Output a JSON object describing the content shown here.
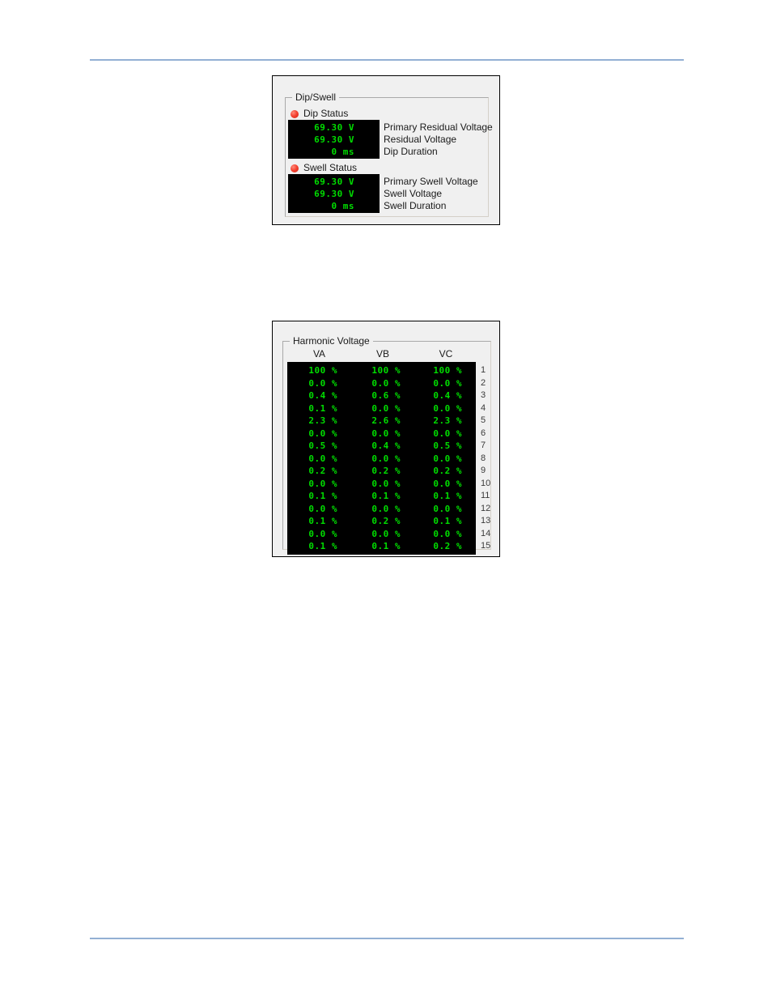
{
  "page": {
    "rule_color": "#93b0d4",
    "background": "#ffffff"
  },
  "dip_swell_panel": {
    "legend": "Dip/Swell",
    "dip": {
      "status_label": "Dip Status",
      "status_led_color": "#f4402f",
      "readouts": [
        {
          "value": "69.30 V",
          "label": "Primary Residual Voltage"
        },
        {
          "value": "69.30 V",
          "label": "Residual Voltage"
        },
        {
          "value": "0 ms",
          "label": "Dip Duration"
        }
      ]
    },
    "swell": {
      "status_label": "Swell Status",
      "status_led_color": "#f4402f",
      "readouts": [
        {
          "value": "69.30 V",
          "label": "Primary Swell Voltage"
        },
        {
          "value": "69.30 V",
          "label": "Swell Voltage"
        },
        {
          "value": "0 ms",
          "label": "Swell Duration"
        }
      ]
    }
  },
  "harmonic_panel": {
    "legend": "Harmonic Voltage",
    "columns": [
      "VA",
      "VB",
      "VC"
    ],
    "lcd_text_color": "#00dd00",
    "lcd_background": "#000000",
    "rows": [
      {
        "index": "1",
        "VA": "100 %",
        "VB": "100 %",
        "VC": "100 %"
      },
      {
        "index": "2",
        "VA": "0.0 %",
        "VB": "0.0 %",
        "VC": "0.0 %"
      },
      {
        "index": "3",
        "VA": "0.4 %",
        "VB": "0.6 %",
        "VC": "0.4 %"
      },
      {
        "index": "4",
        "VA": "0.1 %",
        "VB": "0.0 %",
        "VC": "0.0 %"
      },
      {
        "index": "5",
        "VA": "2.3 %",
        "VB": "2.6 %",
        "VC": "2.3 %"
      },
      {
        "index": "6",
        "VA": "0.0 %",
        "VB": "0.0 %",
        "VC": "0.0 %"
      },
      {
        "index": "7",
        "VA": "0.5 %",
        "VB": "0.4 %",
        "VC": "0.5 %"
      },
      {
        "index": "8",
        "VA": "0.0 %",
        "VB": "0.0 %",
        "VC": "0.0 %"
      },
      {
        "index": "9",
        "VA": "0.2 %",
        "VB": "0.2 %",
        "VC": "0.2 %"
      },
      {
        "index": "10",
        "VA": "0.0 %",
        "VB": "0.0 %",
        "VC": "0.0 %"
      },
      {
        "index": "11",
        "VA": "0.1 %",
        "VB": "0.1 %",
        "VC": "0.1 %"
      },
      {
        "index": "12",
        "VA": "0.0 %",
        "VB": "0.0 %",
        "VC": "0.0 %"
      },
      {
        "index": "13",
        "VA": "0.1 %",
        "VB": "0.2 %",
        "VC": "0.1 %"
      },
      {
        "index": "14",
        "VA": "0.0 %",
        "VB": "0.0 %",
        "VC": "0.0 %"
      },
      {
        "index": "15",
        "VA": "0.1 %",
        "VB": "0.1 %",
        "VC": "0.2 %"
      }
    ]
  }
}
